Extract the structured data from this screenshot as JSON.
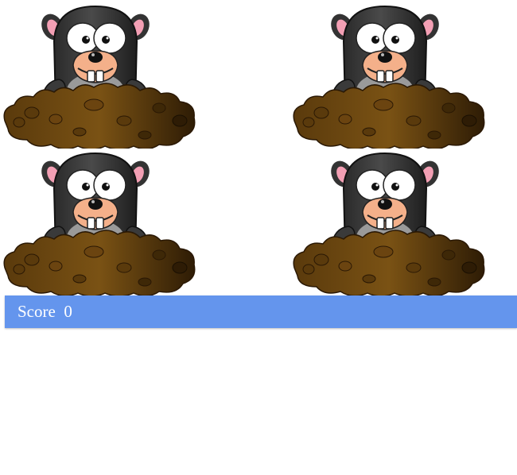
{
  "game": {
    "score_label": "Score",
    "score_value": "0",
    "holes": [
      {
        "id": "hole-1",
        "icon": "mole-icon"
      },
      {
        "id": "hole-2",
        "icon": "mole-icon"
      },
      {
        "id": "hole-3",
        "icon": "mole-icon"
      },
      {
        "id": "hole-4",
        "icon": "mole-icon"
      }
    ]
  },
  "colors": {
    "score_bar": "#6495ed",
    "score_text": "#ffffff",
    "mole_fur": "#3a3a3a",
    "mole_snout": "#f4b08a",
    "dirt": "#6b4410"
  }
}
